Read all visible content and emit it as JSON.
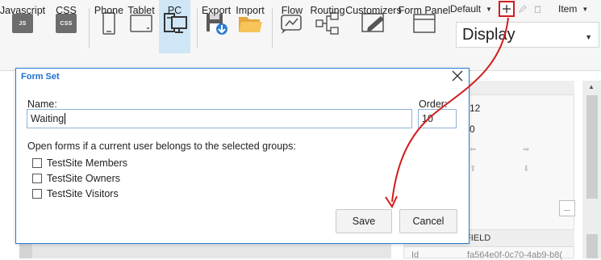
{
  "ribbon": {
    "buttons": [
      {
        "name": "javascript",
        "tile": "JS",
        "label": "Javascript"
      },
      {
        "name": "css",
        "tile": "CSS",
        "label": "CSS"
      },
      {
        "name": "phone",
        "label": "Phone"
      },
      {
        "name": "tablet",
        "label": "Tablet"
      },
      {
        "name": "pc",
        "label": "PC",
        "selected": true
      },
      {
        "name": "export",
        "label": "Export"
      },
      {
        "name": "import",
        "label": "Import"
      },
      {
        "name": "flow",
        "label": "Flow"
      },
      {
        "name": "routing",
        "label": "Routing"
      },
      {
        "name": "customizers",
        "label": "Customizers"
      },
      {
        "name": "form-panel",
        "label": "Form Panel"
      }
    ],
    "form_set_dropdown": "Default",
    "item_dropdown": "Item",
    "view_select": "Display",
    "icons": [
      "plus-icon",
      "pencil-icon",
      "trash-icon"
    ]
  },
  "dialog": {
    "title": "Form Set",
    "name_label": "Name:",
    "name_value": "Waiting",
    "order_label": "Order:",
    "order_value": "10",
    "groups_prompt": "Open forms if a current user belongs to the selected groups:",
    "groups": [
      {
        "label": "TestSite Members",
        "checked": false
      },
      {
        "label": "TestSite Owners",
        "checked": false
      },
      {
        "label": "TestSite Visitors",
        "checked": false
      }
    ],
    "save_label": "Save",
    "cancel_label": "Cancel"
  },
  "properties": {
    "value_1": "12",
    "value_2": "0",
    "ellipsis": "...",
    "field_header": "FIELD",
    "id_label": "Id",
    "id_value": "fa564e0f-0c70-4ab9-b8("
  },
  "colors": {
    "accent": "#1d6fcf",
    "dialog_border": "#2b7fd6",
    "annotation": "#d21c1c",
    "selected_tab": "#cfe6f7"
  }
}
